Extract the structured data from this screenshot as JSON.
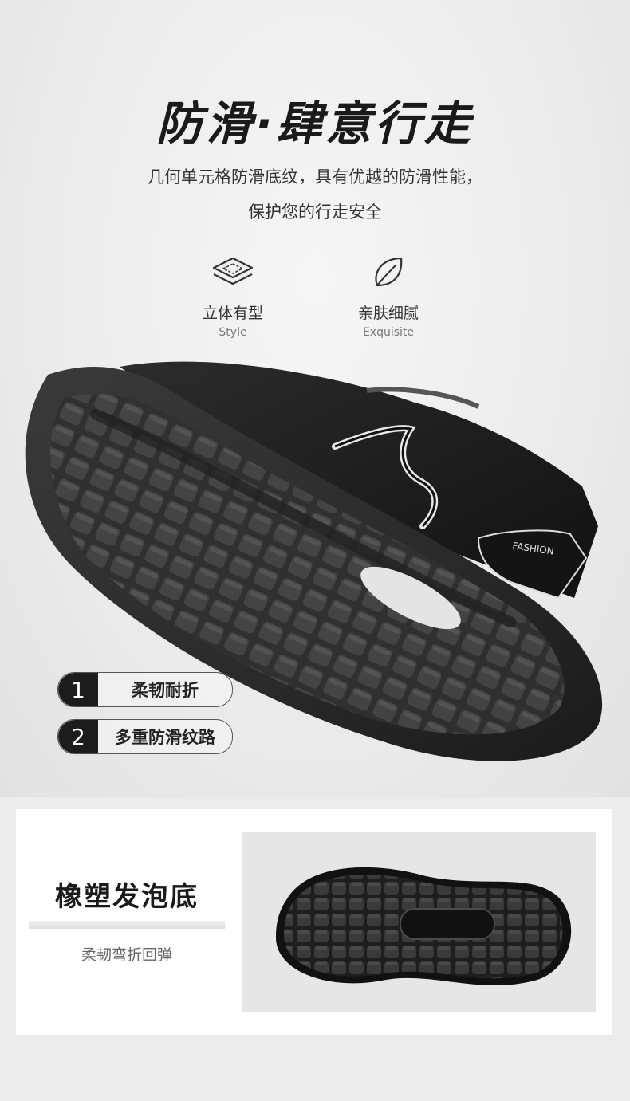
{
  "header": {
    "title": "防滑·肆意行走",
    "subtitle_line1": "几何单元格防滑底纹，具有优越的防滑性能，",
    "subtitle_line2": "保护您的行走安全"
  },
  "features": [
    {
      "label_cn": "立体有型",
      "label_en": "Style",
      "icon": "layers-icon"
    },
    {
      "label_cn": "亲肤细腻",
      "label_en": "Exquisite",
      "icon": "leaf-icon"
    }
  ],
  "shoe_brand_text": "FASHION",
  "tags": [
    {
      "number": "1",
      "label": "柔韧耐折"
    },
    {
      "number": "2",
      "label": "多重防滑纹路"
    }
  ],
  "sole_card": {
    "title": "橡塑发泡底",
    "description": "柔韧弯折回弹"
  }
}
